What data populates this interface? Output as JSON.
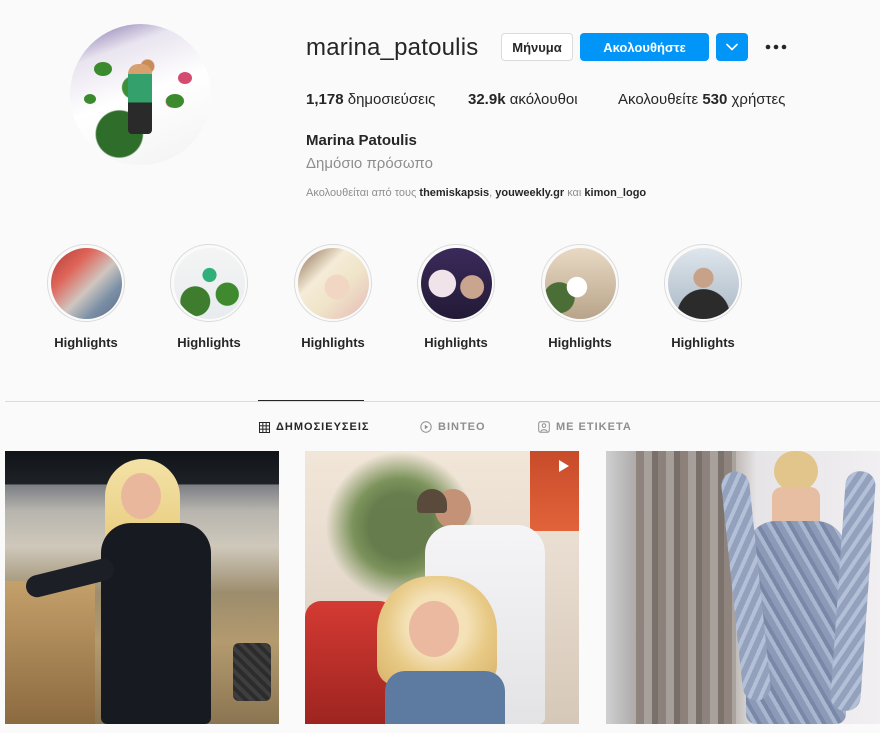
{
  "profile": {
    "username": "marina_patoulis",
    "full_name": "Marina Patoulis",
    "category": "Δημόσιο πρόσωπο",
    "followed_by_prefix": "Ακολουθείται από τους",
    "followed_by_users": [
      "themiskapsis",
      "youweekly.gr",
      "kimon_logo"
    ],
    "followed_by_sep": ",",
    "followed_by_and": "και"
  },
  "actions": {
    "message_label": "Μήνυμα",
    "follow_label": "Ακολουθήστε"
  },
  "stats": {
    "posts_count": "1,178",
    "posts_label": "δημοσιεύσεις",
    "followers_count": "32.9k",
    "followers_label": "ακόλουθοι",
    "following_prefix": "Ακολουθείτε",
    "following_count": "530",
    "following_label": "χρήστες"
  },
  "highlights": [
    {
      "label": "Highlights"
    },
    {
      "label": "Highlights"
    },
    {
      "label": "Highlights"
    },
    {
      "label": "Highlights"
    },
    {
      "label": "Highlights"
    },
    {
      "label": "Highlights"
    }
  ],
  "tabs": [
    {
      "label": "ΔΗΜΟΣΙΕΥΣΕΙΣ",
      "icon": "grid-icon",
      "active": true
    },
    {
      "label": "ΒΙΝΤΕΟ",
      "icon": "video-icon",
      "active": false
    },
    {
      "label": "ΜΕ ΕΤΙΚΕΤΑ",
      "icon": "tag-icon",
      "active": false
    }
  ],
  "colors": {
    "accent": "#0095f6",
    "text": "#262626",
    "muted": "#8e8e8e",
    "border": "#dbdbdb",
    "background": "#fafafa"
  }
}
